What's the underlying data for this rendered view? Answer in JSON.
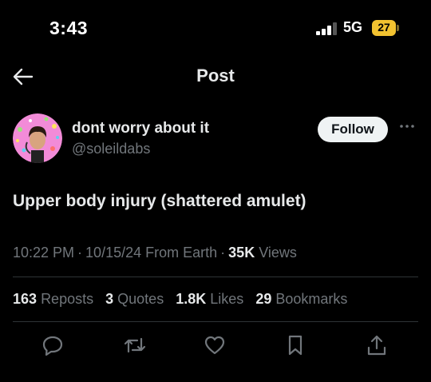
{
  "status_bar": {
    "time": "3:43",
    "network": "5G",
    "battery": "27"
  },
  "header": {
    "title": "Post",
    "back_icon": "arrow-left-icon"
  },
  "author": {
    "display_name": "dont worry about it",
    "handle": "@soleildabs",
    "follow_label": "Follow",
    "more_icon": "more-dots-icon"
  },
  "post": {
    "text": "Upper body injury (shattered amulet)",
    "time": "10:22 PM",
    "date": "10/15/24",
    "source": "From Earth",
    "views_count": "35K",
    "views_label": "Views"
  },
  "stats": [
    {
      "count": "163",
      "label": "Reposts"
    },
    {
      "count": "3",
      "label": "Quotes"
    },
    {
      "count": "1.8K",
      "label": "Likes"
    },
    {
      "count": "29",
      "label": "Bookmarks"
    }
  ],
  "actions": [
    "reply-icon",
    "repost-icon",
    "like-icon",
    "bookmark-icon",
    "share-icon"
  ],
  "colors": {
    "background": "#000000",
    "text": "#e7e9ea",
    "secondary": "#71767b",
    "battery": "#f2c230",
    "avatar_bg": "#f28bd8"
  }
}
